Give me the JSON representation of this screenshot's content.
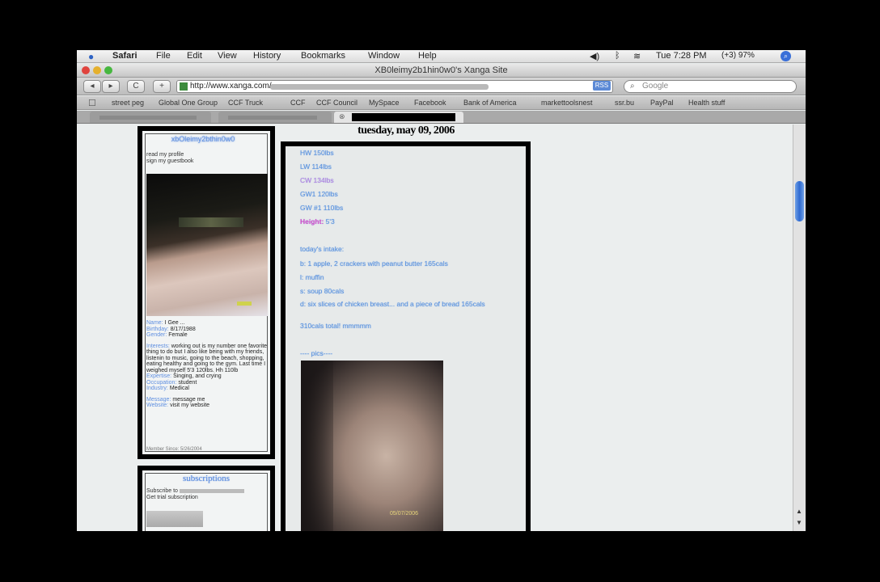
{
  "menubar": {
    "app": "Safari",
    "items": [
      "File",
      "Edit",
      "View",
      "History",
      "Bookmarks",
      "Window",
      "Help"
    ],
    "clock": "Tue 7:28 PM",
    "battery": "(+3) 97%"
  },
  "window": {
    "title": "XB0leimy2b1hin0w0's Xanga Site"
  },
  "toolbar": {
    "back_label": "◂",
    "forward_label": "▸",
    "reload_label": "C",
    "add_label": "+",
    "url": "http://www.xanga.com/",
    "rss_label": "RSS",
    "search_placeholder": "Google"
  },
  "bookmarks": [
    "street peg",
    "Global One Group",
    "CCF Truck",
    "CCF",
    "CCF Council",
    "MySpace",
    "Facebook",
    "Bank of America",
    "markettoolsnest",
    "ssr.bu",
    "PayPal",
    "Health stuff"
  ],
  "sidebar": {
    "name": "xbOleimy2bthin0w0",
    "links": [
      "read my profile",
      "sign my guestbook"
    ],
    "info_lines": [
      {
        "label": "Name:",
        "value": "I Gee ..."
      },
      {
        "label": "Birthday:",
        "value": "8/17/1988"
      },
      {
        "label": "Gender:",
        "value": "Female"
      }
    ],
    "interests_label": "Interests:",
    "interests": "working out is my number one favorite thing to do but I also like being with my friends, listenin to music, going to the beach, shopping, eating healthy and going to the gym. Last time I weighed myself 5'3 120lbs. Hh 110lb",
    "expertise_label": "Expertise:",
    "expertise": "Singing, and crying",
    "occupation_label": "Occupation:",
    "occupation": "student",
    "industry_label": "Industry:",
    "industry": "Medical",
    "message_label": "Message:",
    "message": "message me",
    "website_label": "Website:",
    "website": "visit my website",
    "member_since": "Member Since: 5/26/2004"
  },
  "subscriptions": {
    "title": "subscriptions",
    "line1": "Subscribe to",
    "line2": "Get trial subscription"
  },
  "post": {
    "date": "tuesday, may 09, 2006",
    "lines": [
      {
        "text": "HW 150lbs",
        "style": "blue"
      },
      {
        "text": "LW 114lbs",
        "style": "blue"
      },
      {
        "text": "CW 134lbs",
        "style": "lav"
      },
      {
        "text": "GW1 120lbs",
        "style": "blue"
      },
      {
        "text": "GW #1 110lbs",
        "style": "blue"
      },
      {
        "label": "Height:",
        "text": "5'3",
        "style": "height"
      },
      {
        "text": "today's intake:",
        "style": "blue"
      },
      {
        "text": "b: 1 apple, 2 crackers with peanut butter 165cals",
        "style": "blue"
      },
      {
        "text": "l: muffin",
        "style": "blue"
      },
      {
        "text": "s: soup 80cals",
        "style": "blue"
      },
      {
        "text": "d: six slices of chicken breast... and a piece of bread 165cals",
        "style": "blue"
      },
      {
        "text": "310cals total! mmmmm",
        "style": "blue"
      },
      {
        "text": "---- pics----",
        "style": "blue"
      }
    ],
    "photo_timestamp": "05/07/2006"
  }
}
